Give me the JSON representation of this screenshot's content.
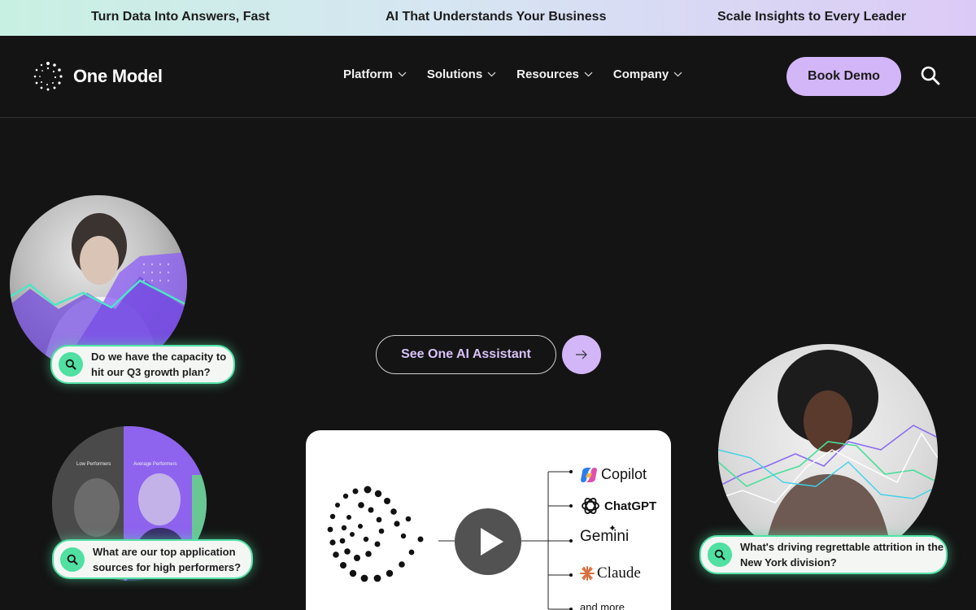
{
  "announcement": {
    "items": [
      "Turn Data Into Answers, Fast",
      "AI That Understands Your Business",
      "Scale Insights to Every Leader"
    ]
  },
  "nav": {
    "logo_text": "One Model",
    "menu": [
      "Platform",
      "Solutions",
      "Resources",
      "Company"
    ],
    "book_demo": "Book Demo",
    "search_icon": "search-icon"
  },
  "hero": {
    "cta_label": "See One AI Assistant",
    "cta_icon": "arrow-right-icon"
  },
  "questions": [
    "Do we have the capacity to hit our Q3 growth plan?",
    "What are our top application sources for high performers?",
    "What's driving regrettable attrition in the New York division?"
  ],
  "chart_labels": {
    "low": "Low Performers",
    "average": "Average Performers"
  },
  "integrations": {
    "items": [
      "Copilot",
      "ChatGPT",
      "Gemini",
      "Claude",
      "and more"
    ]
  },
  "colors": {
    "accent_purple": "#d3b6f7",
    "accent_green": "#54e1a6",
    "background": "#141414"
  }
}
